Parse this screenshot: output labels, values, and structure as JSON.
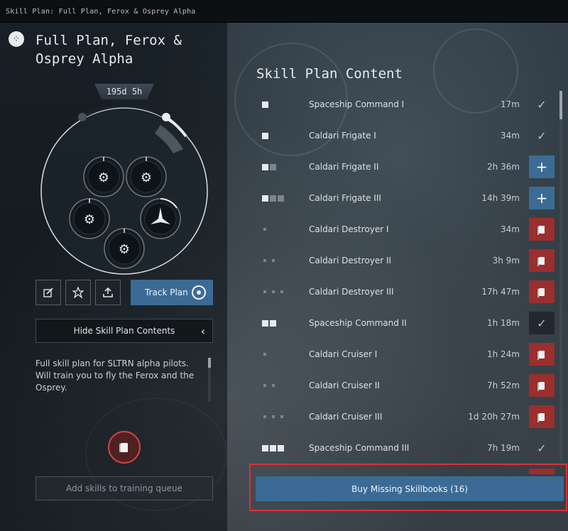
{
  "window": {
    "title": "Skill Plan: Full Plan, Ferox & Osprey Alpha"
  },
  "plan": {
    "icon": "skill-plan-icon",
    "title": "Full Plan, Ferox & Osprey Alpha",
    "duration": "195d 5h",
    "description": "Full skill plan for SLTRN alpha pilots. Will train you to fly the Ferox and the Osprey."
  },
  "toolbar": {
    "edit_icon": "edit-icon",
    "share_icon": "share-icon",
    "export_icon": "export-icon",
    "track_label": "Track Plan"
  },
  "hide_contents_label": "Hide Skill Plan Contents",
  "add_queue_label": "Add skills to training queue",
  "content": {
    "title": "Skill Plan Content",
    "skills": [
      {
        "name": "Spaceship Command I",
        "time": "17m",
        "action": "check"
      },
      {
        "name": "Caldari Frigate I",
        "time": "34m",
        "action": "check"
      },
      {
        "name": "Caldari Frigate II",
        "time": "2h 36m",
        "action": "plus"
      },
      {
        "name": "Caldari Frigate III",
        "time": "14h 39m",
        "action": "plus"
      },
      {
        "name": "Caldari Destroyer I",
        "time": "34m",
        "action": "buy"
      },
      {
        "name": "Caldari Destroyer II",
        "time": "3h 9m",
        "action": "buy"
      },
      {
        "name": "Caldari Destroyer III",
        "time": "17h 47m",
        "action": "buy"
      },
      {
        "name": "Spaceship Command II",
        "time": "1h 18m",
        "action": "check"
      },
      {
        "name": "Caldari Cruiser I",
        "time": "1h 24m",
        "action": "buy"
      },
      {
        "name": "Caldari Cruiser II",
        "time": "7h 52m",
        "action": "buy"
      },
      {
        "name": "Caldari Cruiser III",
        "time": "1d 20h 27m",
        "action": "buy"
      },
      {
        "name": "Spaceship Command III",
        "time": "7h 19m",
        "action": "check"
      }
    ]
  },
  "buy_missing_label": "Buy Missing Skillbooks (16)"
}
